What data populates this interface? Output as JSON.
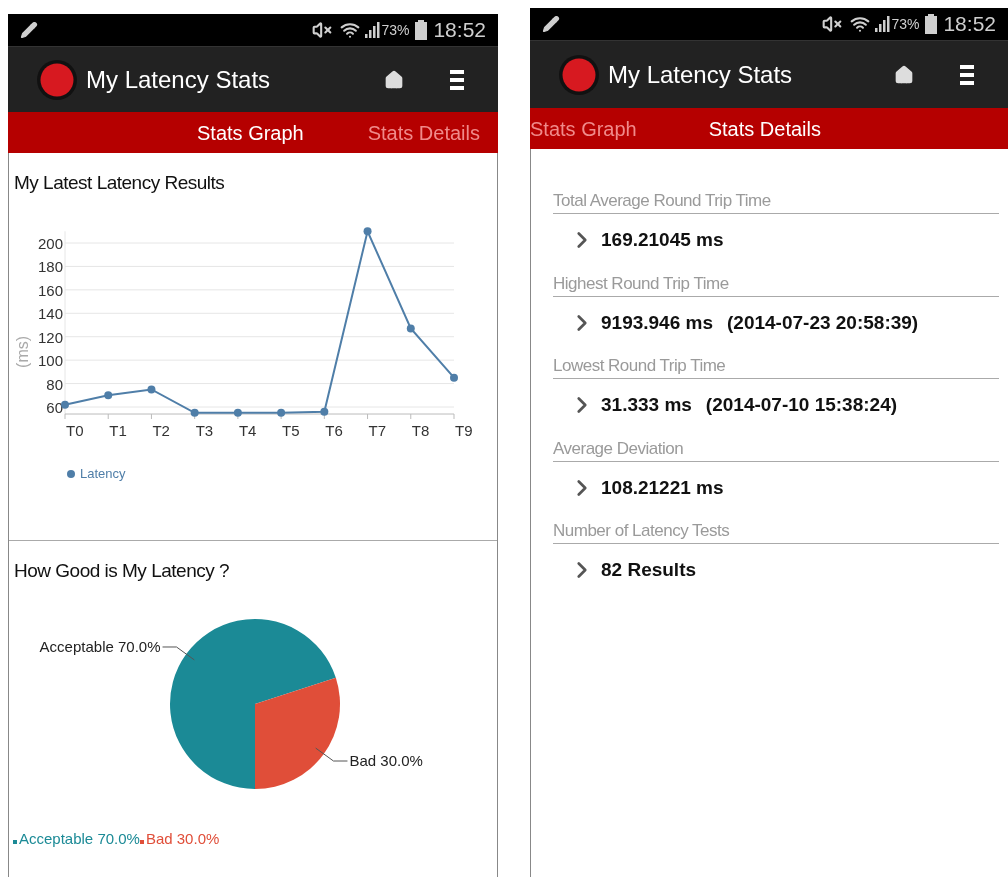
{
  "screens": [
    {
      "kind": "graph",
      "status_bar": {
        "battery": "73%",
        "time": "18:52"
      },
      "app_bar": {
        "title": "My Latency Stats"
      },
      "tabs": [
        {
          "label": "Stats Graph",
          "selected": true
        },
        {
          "label": "Stats Details",
          "selected": false
        }
      ],
      "sections": [
        {
          "title": "My Latest Latency Results",
          "chart_data": {
            "type": "line",
            "ylabel": "(ms)",
            "categories": [
              "T0",
              "T1",
              "T2",
              "T3",
              "T4",
              "T5",
              "T6",
              "T7",
              "T8",
              "T9"
            ],
            "grid": true,
            "ylim": [
              54,
              210
            ],
            "yticks": [
              60,
              80,
              100,
              120,
              140,
              160,
              180,
              200
            ],
            "series": [
              {
                "name": "Latency",
                "color": "#4f7ea8",
                "marker": true,
                "values": [
                  62,
                  70,
                  75,
                  55,
                  55,
                  55,
                  56,
                  210,
                  127,
                  85
                ]
              }
            ]
          }
        },
        {
          "title": "How Good is My Latency ?",
          "chart_data": {
            "type": "pie",
            "categories": [
              "Acceptable 70.0%",
              "Bad 30.0%"
            ],
            "values": [
              70,
              30
            ],
            "colors": [
              "#1b8a96",
              "#e04e39"
            ]
          }
        }
      ]
    },
    {
      "kind": "details",
      "status_bar": {
        "battery": "73%",
        "time": "18:52"
      },
      "app_bar": {
        "title": "My Latency Stats"
      },
      "tabs": [
        {
          "label": "Stats Graph",
          "selected": false
        },
        {
          "label": "Stats Details",
          "selected": true
        }
      ],
      "details": [
        {
          "label": "Total Average Round Trip Time",
          "value": "169.21045 ms"
        },
        {
          "label": "Highest Round Trip Time",
          "value": "9193.946 ms",
          "timestamp": "(2014-07-23 20:58:39)"
        },
        {
          "label": "Lowest Round Trip Time",
          "value": "31.333 ms",
          "timestamp": "(2014-07-10 15:38:24)"
        },
        {
          "label": "Average Deviation",
          "value": "108.21221 ms"
        },
        {
          "label": "Number of Latency Tests",
          "value": "82 Results"
        }
      ]
    }
  ]
}
